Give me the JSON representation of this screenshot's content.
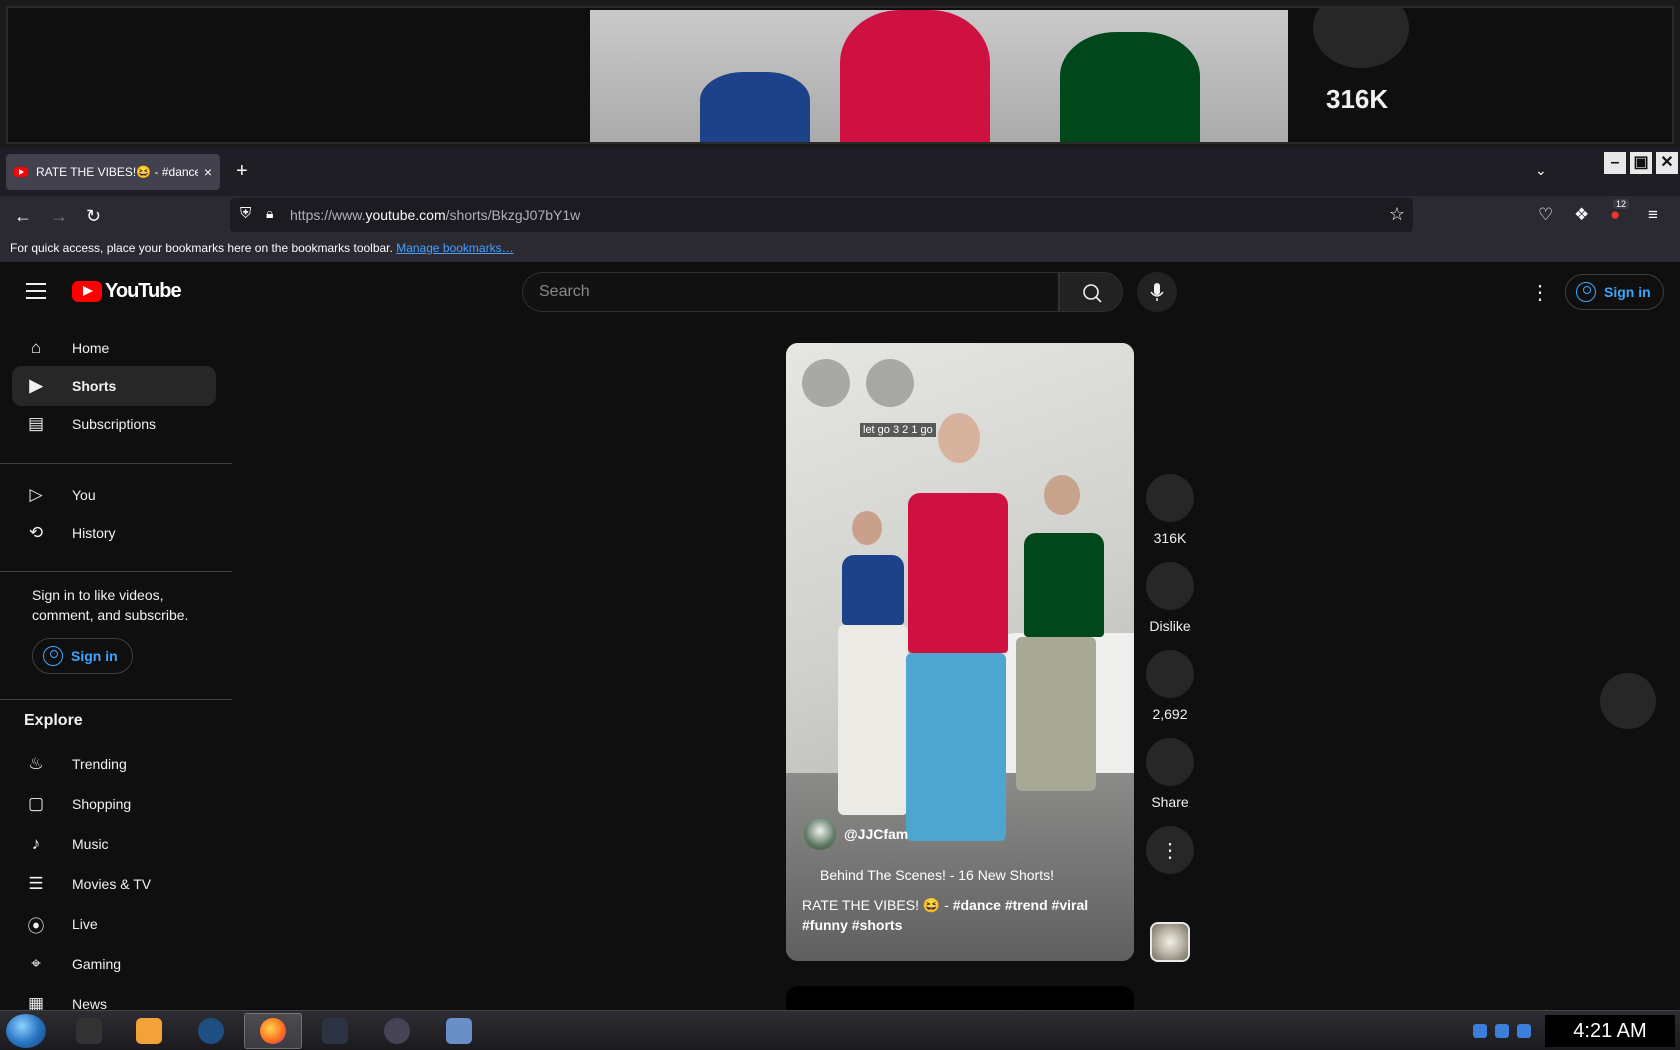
{
  "preview": {
    "like_count": "316K"
  },
  "browser": {
    "tab_title": "RATE THE VIBES!😆 - #dance #",
    "tab_close": "×",
    "new_tab": "+",
    "tab_list": "⌄",
    "window_controls": [
      "–",
      "▣",
      "✕"
    ],
    "url_prefix": "https://www.",
    "url_domain": "youtube.com",
    "url_path": "/shorts/BkzgJ07bY1w",
    "extension_badge": "12",
    "bookmarks_text": "For quick access, place your bookmarks here on the bookmarks toolbar.",
    "bookmarks_link": "Manage bookmarks…"
  },
  "youtube": {
    "logo_text": "YouTube",
    "search_placeholder": "Search",
    "signin_label": "Sign in",
    "sidebar": {
      "primary": [
        {
          "label": "Home",
          "icon": "home-icon"
        },
        {
          "label": "Shorts",
          "icon": "shorts-icon"
        },
        {
          "label": "Subscriptions",
          "icon": "subscriptions-icon"
        }
      ],
      "you": [
        {
          "label": "You",
          "icon": "you-icon"
        },
        {
          "label": "History",
          "icon": "history-icon"
        }
      ],
      "signin_prompt": "Sign in to like videos, comment, and subscribe.",
      "signin_label": "Sign in",
      "explore_title": "Explore",
      "explore": [
        {
          "label": "Trending",
          "icon": "trending-icon"
        },
        {
          "label": "Shopping",
          "icon": "shopping-icon"
        },
        {
          "label": "Music",
          "icon": "music-icon"
        },
        {
          "label": "Movies & TV",
          "icon": "movies-icon"
        },
        {
          "label": "Live",
          "icon": "live-icon"
        },
        {
          "label": "Gaming",
          "icon": "gaming-icon"
        },
        {
          "label": "News",
          "icon": "news-icon"
        }
      ]
    },
    "short": {
      "caption": "let go 3 2 1 go",
      "channel": "@JJCfam",
      "linked_short": "Behind The Scenes! - 16 New Shorts!",
      "title_plain": "RATE THE VIBES! 😆 - ",
      "title_tags": "#dance #trend #viral #funny #shorts"
    },
    "actions": {
      "like_count": "316K",
      "dislike_label": "Dislike",
      "comment_count": "2,692",
      "share_label": "Share",
      "more": "⋮"
    }
  },
  "taskbar": {
    "clock": "4:21 AM"
  }
}
